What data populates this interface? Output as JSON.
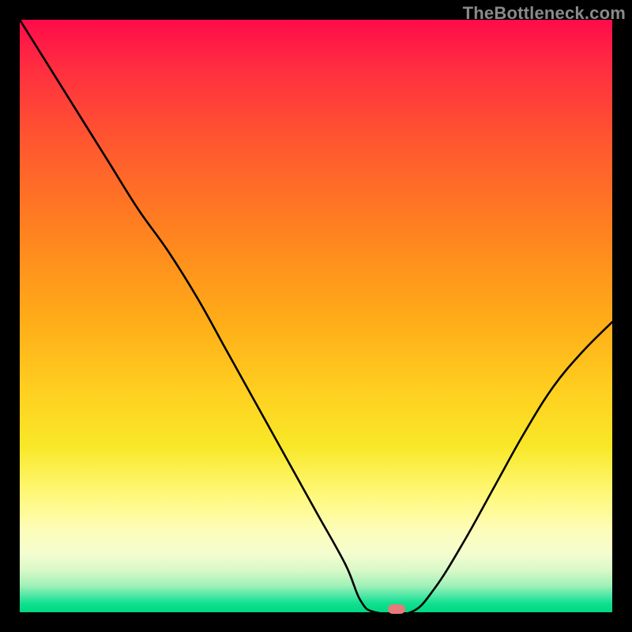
{
  "watermark": "TheBottleneck.com",
  "marker": {
    "x_frac": 0.636,
    "y_frac": 0.994
  },
  "chart_data": {
    "type": "line",
    "title": "",
    "xlabel": "",
    "ylabel": "",
    "xlim": [
      0,
      1
    ],
    "ylim": [
      0,
      1
    ],
    "series": [
      {
        "name": "curve",
        "x": [
          0.0,
          0.05,
          0.1,
          0.15,
          0.2,
          0.25,
          0.3,
          0.35,
          0.4,
          0.45,
          0.5,
          0.55,
          0.575,
          0.6,
          0.66,
          0.7,
          0.75,
          0.8,
          0.85,
          0.9,
          0.95,
          1.0
        ],
        "y": [
          1.0,
          0.92,
          0.84,
          0.76,
          0.68,
          0.61,
          0.53,
          0.44,
          0.35,
          0.26,
          0.17,
          0.08,
          0.02,
          0.0,
          0.0,
          0.04,
          0.12,
          0.21,
          0.3,
          0.38,
          0.44,
          0.49
        ]
      }
    ],
    "annotations": [
      {
        "text": "TheBottleneck.com",
        "role": "watermark"
      }
    ]
  }
}
